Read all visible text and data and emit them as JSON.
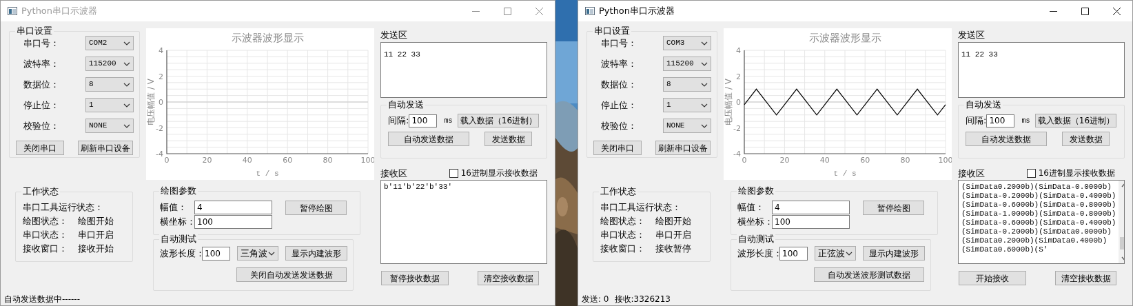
{
  "windows": [
    {
      "title": "Python串口示波器",
      "active": false,
      "serial_settings": {
        "title": "串口设置",
        "fields": [
          {
            "label": "串口号：",
            "value": "COM2"
          },
          {
            "label": "波特率：",
            "value": "115200"
          },
          {
            "label": "数据位：",
            "value": "8"
          },
          {
            "label": "停止位：",
            "value": "1"
          },
          {
            "label": "校验位：",
            "value": "NONE"
          }
        ],
        "buttons": [
          "关闭串口",
          "刷新串口设备"
        ]
      },
      "work_status": {
        "title": "工作状态",
        "heading": "串口工具运行状态：",
        "rows": [
          {
            "label": "绘图状态：",
            "value": "绘图开始"
          },
          {
            "label": "串口状态：",
            "value": "串口开启"
          },
          {
            "label": "接收窗口：",
            "value": "接收开始"
          }
        ]
      },
      "chart": {
        "chart_data": {
          "type": "line",
          "title": "示波器波形显示",
          "xlabel": "t / s",
          "ylabel": "电压幅值 / V",
          "xlim": [
            0,
            100
          ],
          "ylim": [
            -4,
            4
          ],
          "xticks": [
            0,
            20,
            40,
            60,
            80,
            100
          ],
          "yticks": [
            -4,
            -2,
            0,
            2,
            4
          ],
          "grid": true
        }
      },
      "plot_params": {
        "title": "绘图参数",
        "fields": [
          {
            "label": "幅值：",
            "value": "4"
          },
          {
            "label": "横坐标：",
            "value": "100"
          }
        ],
        "button": "暂停绘图"
      },
      "auto_test": {
        "title": "自动测试",
        "length_label": "波形长度：",
        "length": "100",
        "waveform": "三角波",
        "buttons": [
          "显示内建波形",
          "关闭自动发送发送数据"
        ]
      },
      "send_area": {
        "label": "发送区",
        "value": "11 22 33"
      },
      "auto_send": {
        "title": "自动发送",
        "interval_label": "间隔:",
        "interval": "100",
        "unit": "ms",
        "load_button": "载入数据（16进制）",
        "buttons": [
          "自动发送数据",
          "发送数据"
        ]
      },
      "receive_area": {
        "label": "接收区",
        "hex_checkbox": {
          "label": "16进制显示接收数据",
          "checked": false
        },
        "lines": [
          "b'11'b'22'b'33'"
        ],
        "buttons": [
          "暂停接收数据",
          "清空接收数据"
        ]
      },
      "status_bar": [
        "自动发送数据中------"
      ]
    },
    {
      "title": "Python串口示波器",
      "active": true,
      "serial_settings": {
        "title": "串口设置",
        "fields": [
          {
            "label": "串口号：",
            "value": "COM3"
          },
          {
            "label": "波特率：",
            "value": "115200"
          },
          {
            "label": "数据位：",
            "value": "8"
          },
          {
            "label": "停止位：",
            "value": "1"
          },
          {
            "label": "校验位：",
            "value": "NONE"
          }
        ],
        "buttons": [
          "关闭串口",
          "刷新串口设备"
        ]
      },
      "work_status": {
        "title": "工作状态",
        "heading": "串口工具运行状态：",
        "rows": [
          {
            "label": "绘图状态：",
            "value": "绘图开始"
          },
          {
            "label": "串口状态：",
            "value": "串口开启"
          },
          {
            "label": "接收窗口：",
            "value": "接收暂停"
          }
        ]
      },
      "chart": {
        "chart_data": {
          "type": "line",
          "title": "示波器波形显示",
          "xlabel": "t / s",
          "ylabel": "电压幅值 / V",
          "xlim": [
            0,
            100
          ],
          "ylim": [
            -4,
            4
          ],
          "xticks": [
            0,
            20,
            40,
            60,
            80,
            100
          ],
          "yticks": [
            -4,
            -2,
            0,
            2,
            4
          ],
          "x": [
            0,
            6,
            16,
            26,
            36,
            46,
            56,
            66,
            76,
            86,
            96,
            100
          ],
          "grid": true,
          "series": [
            {
              "color": "#000000",
              "values": [
                -0.2,
                1,
                -1,
                1,
                -1,
                1,
                -1,
                1,
                -1,
                1,
                -1,
                -0.2
              ]
            }
          ]
        }
      },
      "plot_params": {
        "title": "绘图参数",
        "fields": [
          {
            "label": "幅值：",
            "value": "4"
          },
          {
            "label": "横坐标：",
            "value": "100"
          }
        ],
        "button": "暂停绘图"
      },
      "auto_test": {
        "title": "自动测试",
        "length_label": "波形长度：",
        "length": "100",
        "waveform": "正弦波",
        "buttons": [
          "显示内建波形",
          "自动发送波形测试数据"
        ]
      },
      "send_area": {
        "label": "发送区",
        "value": "11 22 33"
      },
      "auto_send": {
        "title": "自动发送",
        "interval_label": "间隔:",
        "interval": "100",
        "unit": "ms",
        "load_button": "载入数据（16进制）",
        "buttons": [
          "自动发送数据",
          "发送数据"
        ]
      },
      "receive_area": {
        "label": "接收区",
        "hex_checkbox": {
          "label": "16进制显示接收数据",
          "checked": false
        },
        "lines": [
          "(SimData0.2000b)(SimData-0.0000b)",
          "(SimData-0.2000b)(SimData-0.4000b)",
          "(SimData-0.6000b)(SimData-0.8000b)",
          "(SimData-1.0000b)(SimData-0.8000b)",
          "(SimData-0.6000b)(SimData-0.4000b)",
          "(SimData-0.2000b)(SimData0.0000b)",
          "(SimData0.2000b)(SimData0.4000b)",
          "(SimData0.6000b)(S'"
        ],
        "buttons": [
          "开始接收",
          "清空接收数据"
        ]
      },
      "status_bar": [
        "发送: 0",
        "接收:3326213"
      ]
    }
  ]
}
